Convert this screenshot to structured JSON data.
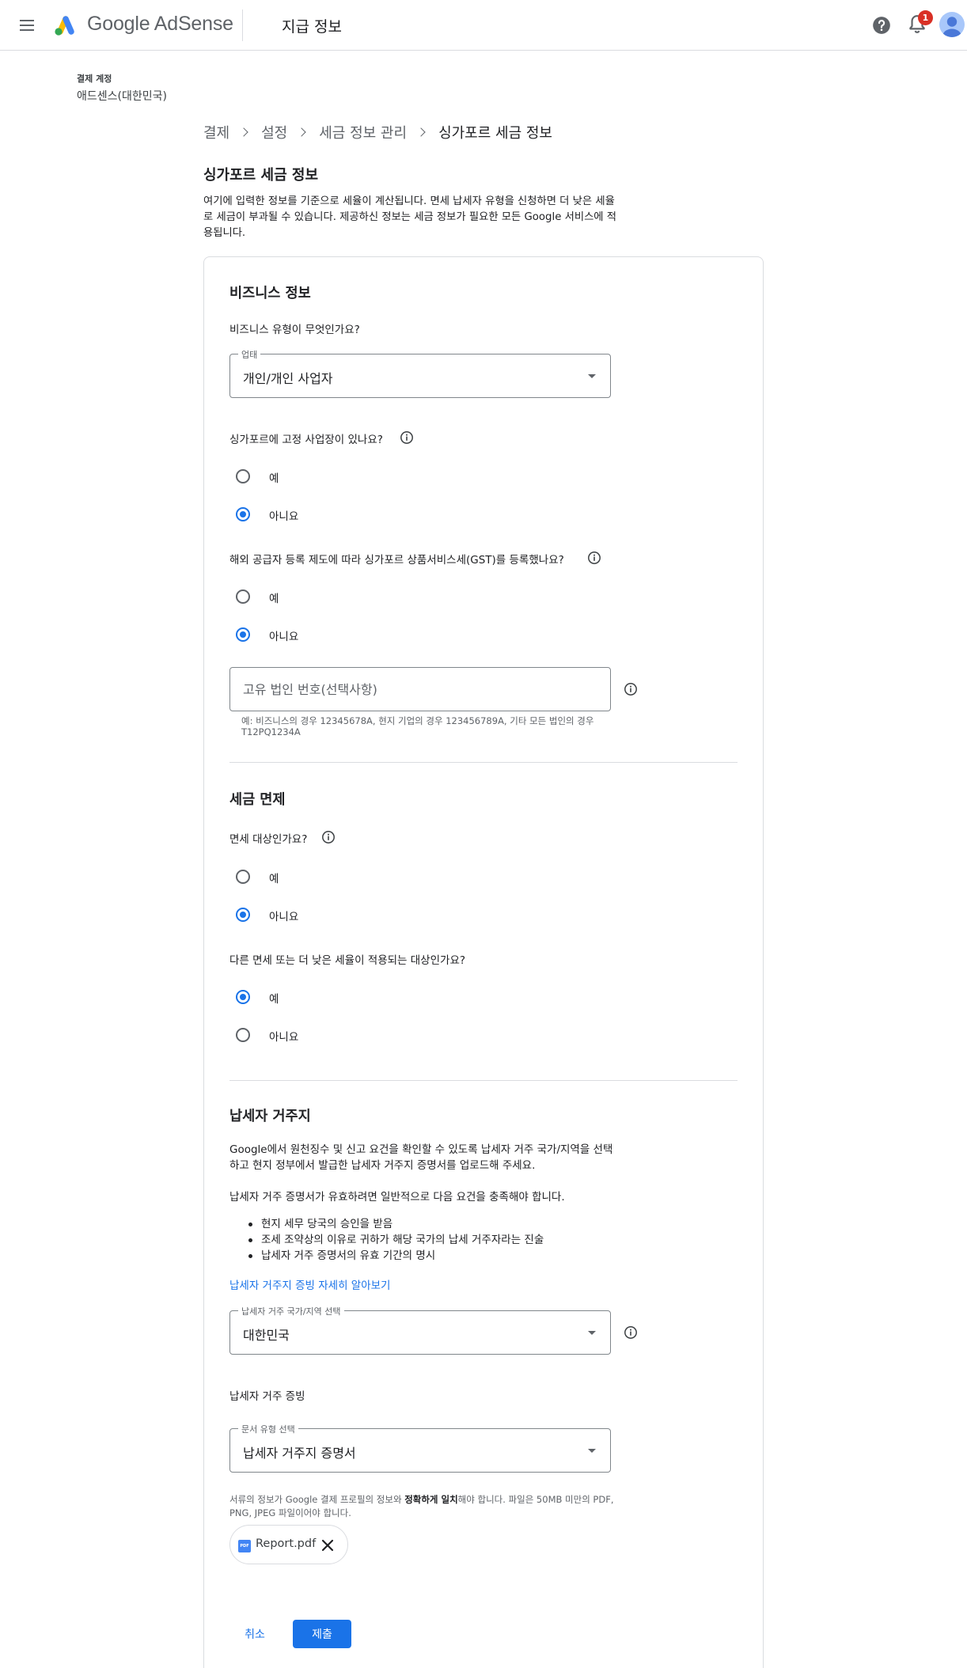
{
  "app": {
    "brand": "Google AdSense",
    "page_title": "지급 정보",
    "notification_count": "1"
  },
  "account": {
    "label": "결제 계정",
    "name": "애드센스(대한민국)"
  },
  "breadcrumb": {
    "items": [
      "결제",
      "설정",
      "세금 정보 관리",
      "싱가포르 세금 정보"
    ]
  },
  "section": {
    "title": "싱가포르 세금 정보",
    "description": "여기에 입력한 정보를 기준으로 세율이 계산됩니다. 면세 납세자 유형을 신청하면 더 낮은 세율로 세금이 부과될 수 있습니다. 제공하신 정보는 세금 정보가 필요한 모든 Google 서비스에 적용됩니다."
  },
  "business": {
    "title": "비즈니스 정보",
    "type_question": "비즈니스 유형이 무엇인가요?",
    "type_select": {
      "label": "업태",
      "value": "개인/개인 사업자"
    },
    "fixed_place_question": "싱가포르에 고정 사업장이 있나요?",
    "fixed_place_options": [
      {
        "label": "예",
        "selected": false
      },
      {
        "label": "아니요",
        "selected": true
      }
    ],
    "gst_question": "해외 공급자 등록 제도에 따라 싱가포르 상품서비스세(GST)를 등록했나요?",
    "gst_options": [
      {
        "label": "예",
        "selected": false
      },
      {
        "label": "아니요",
        "selected": true
      }
    ],
    "uen_input": {
      "value": "",
      "placeholder": "고유 법인 번호(선택사항)",
      "hint": "예: 비즈니스의 경우 12345678A, 현지 기업의 경우 123456789A, 기타 모든 법인의 경우 T12PQ1234A"
    }
  },
  "exemption": {
    "title": "세금 면제",
    "exempt_question": "면세 대상인가요?",
    "exempt_options": [
      {
        "label": "예",
        "selected": false
      },
      {
        "label": "아니요",
        "selected": true
      }
    ],
    "reduced_question": "다른 면세 또는 더 낮은 세율이 적용되는 대상인가요?",
    "reduced_options": [
      {
        "label": "예",
        "selected": true
      },
      {
        "label": "아니요",
        "selected": false
      }
    ]
  },
  "residency": {
    "title": "납세자 거주지",
    "intro": "Google에서 원천징수 및 신고 요건을 확인할 수 있도록 납세자 거주 국가/지역을 선택하고 현지 정부에서 발급한 납세자 거주지 증명서를 업로드해 주세요.",
    "requirements_intro": "납세자 거주 증명서가 유효하려면 일반적으로 다음 요건을 충족해야 합니다.",
    "requirements": [
      "현지 세무 당국의 승인을 받음",
      "조세 조약상의 이유로 귀하가 해당 국가의 납세 거주자라는 진술",
      "납세자 거주 증명서의 유효 기간의 명시"
    ],
    "learn_more": "납세자 거주지 증빙 자세히 알아보기",
    "country_select": {
      "label": "납세자 거주 국가/지역 선택",
      "value": "대한민국"
    },
    "proof_title": "납세자 거주 증빙",
    "doc_select": {
      "label": "문서 유형 선택",
      "value": "납세자 거주지 증명서"
    },
    "note_prefix": "서류의 정보가 Google 결제 프로필의 정보와 ",
    "note_bold": "정확하게 일치",
    "note_suffix": "해야 합니다. 파일은 50MB 미만의 PDF, PNG, JPEG 파일이어야 합니다.",
    "file": {
      "icon_text": "PDF",
      "name": "Report.pdf"
    }
  },
  "actions": {
    "cancel": "취소",
    "submit": "제출"
  },
  "colors": {
    "primary": "#1a73e8",
    "badge": "#d93025",
    "border": "#dadce0",
    "text": "#202124",
    "muted": "#5f6368"
  }
}
